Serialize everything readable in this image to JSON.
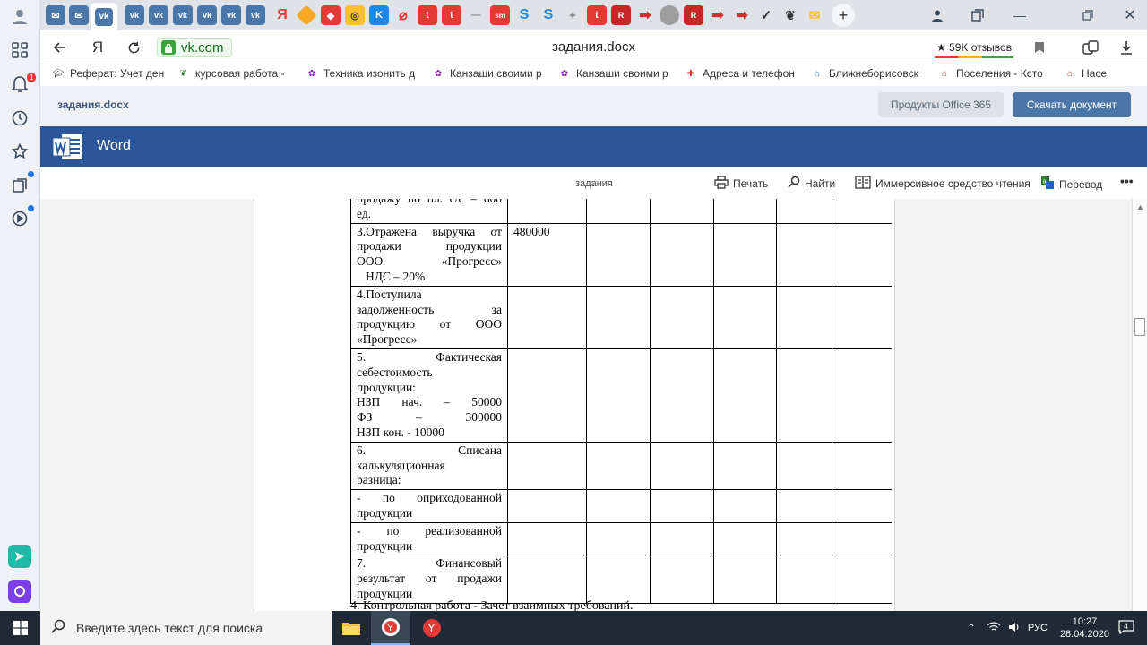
{
  "browser": {
    "url_host": "vk.com",
    "tab_title": "задания.docx",
    "reviews_label": "★ 59K отзывов",
    "bookmarks": [
      {
        "label": "Реферат: Учет ден",
        "icon": "graduation-cap-icon"
      },
      {
        "label": "курсовая работа -",
        "icon": "leaf-icon"
      },
      {
        "label": "Техника изонить д",
        "icon": "flower-icon"
      },
      {
        "label": "Канзаши своими р",
        "icon": "flower-icon"
      },
      {
        "label": "Канзаши своими р",
        "icon": "flower-icon"
      },
      {
        "label": "Адреса и телефон",
        "icon": "map-pin-icon"
      },
      {
        "label": "Ближнеборисовск",
        "icon": "building-icon"
      },
      {
        "label": "Поселения - Ксто",
        "icon": "building-icon"
      },
      {
        "label": "Насе",
        "icon": "building-icon"
      }
    ]
  },
  "viewer": {
    "doc_name": "задания.docx",
    "office_button": "Продукты Office 365",
    "download_button": "Скачать документ"
  },
  "word": {
    "app_title": "Word",
    "doc_label": "задания",
    "toolbar": {
      "print": "Печать",
      "find": "Найти",
      "immersive": "Иммерсивное средство чтения",
      "translate": "Перевод",
      "more": "•••"
    }
  },
  "document": {
    "rows": [
      {
        "lines": [
          "продажу по пл. с/с – 600",
          "ед."
        ],
        "value": ""
      },
      {
        "lines": [
          "3.Отражена выручка от",
          "продажи продукции",
          "ООО «Прогресс»",
          "  НДС – 20%"
        ],
        "value": "480000"
      },
      {
        "lines": [
          "4.Поступила",
          "задолженность за",
          "продукцию от ООО",
          "«Прогресс»"
        ],
        "value": ""
      },
      {
        "lines": [
          "5. Фактическая",
          "себестоимость",
          "продукции:",
          "НЗП нач. – 50000",
          "ФЗ – 300000",
          "НЗП кон. - 10000"
        ],
        "value": ""
      },
      {
        "lines": [
          "6. Списана",
          "калькуляционная",
          "разница:"
        ],
        "value": ""
      },
      {
        "lines": [
          "- по оприходованной",
          "продукции"
        ],
        "value": ""
      },
      {
        "lines": [
          "- по реализованной",
          "продукции"
        ],
        "value": ""
      },
      {
        "lines": [
          "7. Финансовый",
          "результат от продажи",
          "продукции"
        ],
        "value": ""
      }
    ],
    "footer_text": "4. Контрольная работа - Зачет взаимных требований."
  },
  "taskbar": {
    "search_placeholder": "Введите здесь текст для поиска",
    "language": "РУС",
    "time": "10:27",
    "date": "28.04.2020",
    "notification_count": "4"
  },
  "sidebar": {
    "notification_badge": "1"
  }
}
